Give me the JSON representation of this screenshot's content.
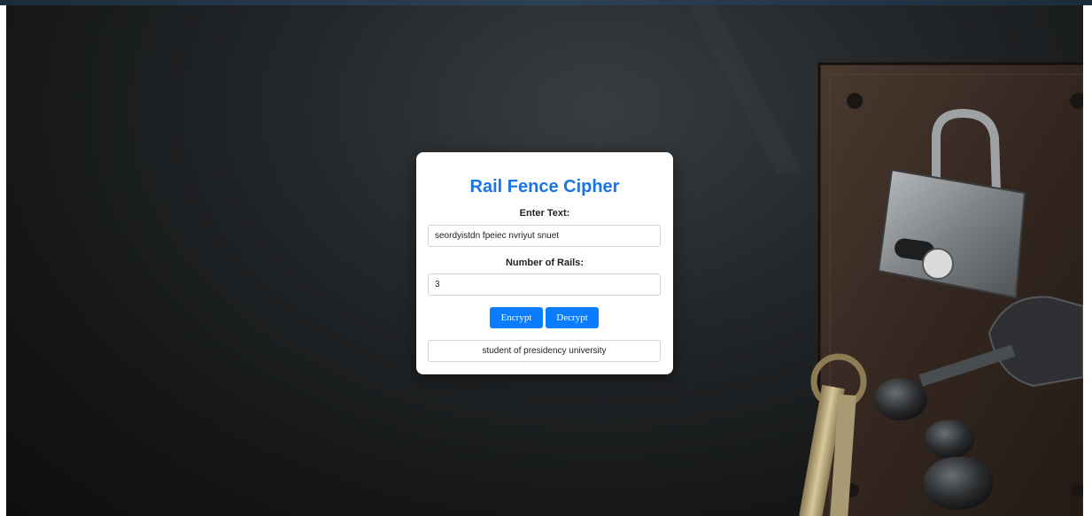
{
  "app": {
    "title": "Rail Fence Cipher"
  },
  "form": {
    "text_label": "Enter Text:",
    "text_value": "seordyistdn fpeiec nvriyut snuet",
    "rails_label": "Number of Rails:",
    "rails_value": "3"
  },
  "actions": {
    "encrypt_label": "Encrypt",
    "decrypt_label": "Decrypt"
  },
  "output": {
    "result": "student of presidency university"
  },
  "theme": {
    "accent": "#1a73e8",
    "button": "#0a7cff",
    "background": "#1b1d1f"
  },
  "background_image": {
    "icons": [
      "padlock-icon",
      "keys-icon",
      "door-plate"
    ]
  }
}
